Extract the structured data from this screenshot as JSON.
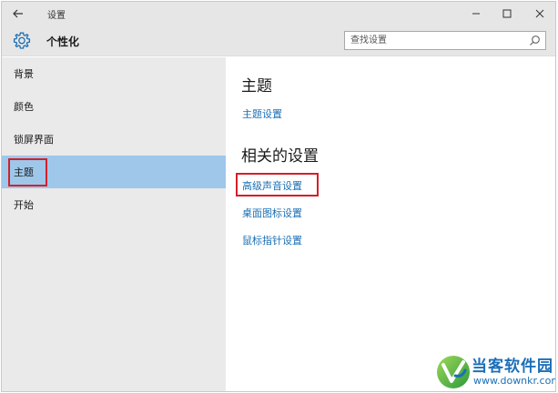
{
  "window": {
    "title": "设置",
    "back_icon": "arrow-left-icon",
    "minimize_glyph": "—",
    "maximize_glyph": "☐",
    "close_glyph": "✕"
  },
  "header": {
    "icon": "gear-icon",
    "title": "个性化",
    "search_placeholder": "查找设置",
    "search_icon": "search-icon"
  },
  "sidebar": {
    "items": [
      {
        "label": "背景",
        "selected": false
      },
      {
        "label": "颜色",
        "selected": false
      },
      {
        "label": "锁屏界面",
        "selected": false
      },
      {
        "label": "主题",
        "selected": true,
        "highlighted": true
      },
      {
        "label": "开始",
        "selected": false
      }
    ]
  },
  "main": {
    "section1": {
      "heading": "主题",
      "links": [
        "主题设置"
      ]
    },
    "section2": {
      "heading": "相关的设置",
      "links": [
        "高级声音设置",
        "桌面图标设置",
        "鼠标指针设置"
      ]
    }
  },
  "watermark": {
    "name": "当客软件园",
    "url": "www.downkr.com"
  },
  "colors": {
    "titlebar_bg": "#e6e6e6",
    "sidebar_bg": "#eaeaea",
    "selected_bg": "#9ec7ea",
    "link": "#1a6fb5",
    "highlight_box": "#d3202a",
    "watermark": "#1c6fb8"
  }
}
